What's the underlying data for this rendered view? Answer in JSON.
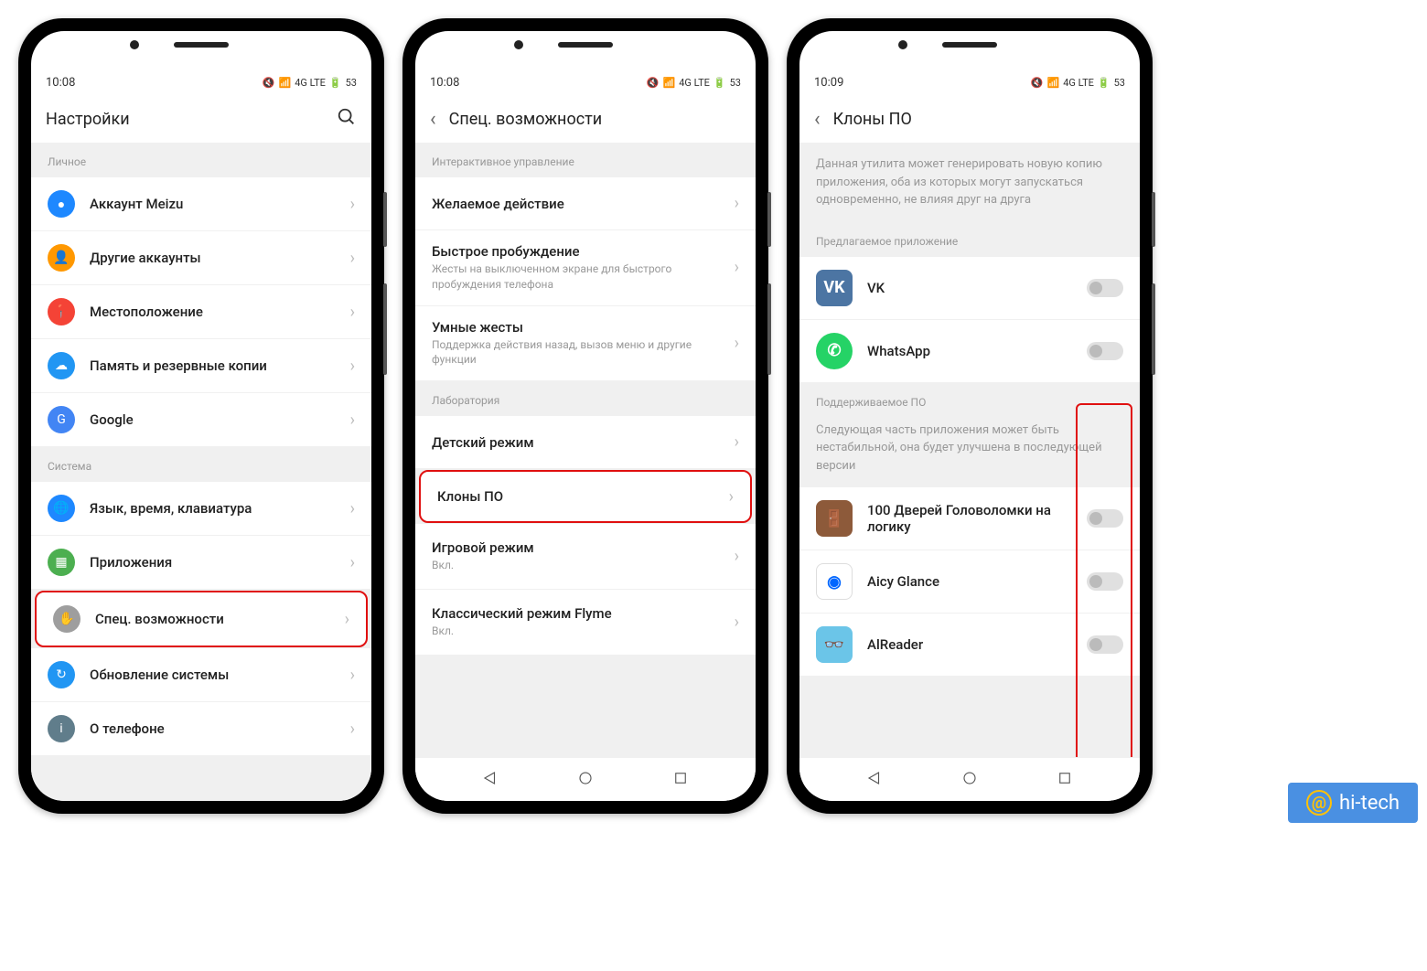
{
  "watermark": "hi-tech",
  "phone1": {
    "time": "10:08",
    "battery": "53",
    "net": "4G LTE",
    "title": "Настройки",
    "sections": [
      {
        "header": "Личное",
        "items": [
          {
            "label": "Аккаунт Meizu",
            "color": "#1e88ff",
            "glyph": "●"
          },
          {
            "label": "Другие аккаунты",
            "color": "#ff9800",
            "glyph": "👤"
          },
          {
            "label": "Местоположение",
            "color": "#f44336",
            "glyph": "📍"
          },
          {
            "label": "Память и резервные копии",
            "color": "#2196f3",
            "glyph": "☁"
          },
          {
            "label": "Google",
            "color": "#4285f4",
            "glyph": "G"
          }
        ]
      },
      {
        "header": "Система",
        "items": [
          {
            "label": "Язык, время, клавиатура",
            "color": "#1e88ff",
            "glyph": "🌐"
          },
          {
            "label": "Приложения",
            "color": "#4caf50",
            "glyph": "▦"
          },
          {
            "label": "Спец. возможности",
            "color": "#9e9e9e",
            "glyph": "✋",
            "highlight": true
          },
          {
            "label": "Обновление системы",
            "color": "#2196f3",
            "glyph": "↻"
          },
          {
            "label": "О телефоне",
            "color": "#607d8b",
            "glyph": "i"
          }
        ]
      }
    ]
  },
  "phone2": {
    "time": "10:08",
    "battery": "53",
    "net": "4G LTE",
    "title": "Спец. возможности",
    "sections": [
      {
        "header": "Интерактивное управление",
        "items": [
          {
            "label": "Желаемое действие"
          },
          {
            "label": "Быстрое пробуждение",
            "sub": "Жесты на выключенном экране для быстрого пробуждения телефона"
          },
          {
            "label": "Умные жесты",
            "sub": "Поддержка действия назад, вызов меню и другие функции"
          }
        ]
      },
      {
        "header": "Лаборатория",
        "items": [
          {
            "label": "Детский режим"
          },
          {
            "label": "Клоны ПО",
            "highlight": true
          },
          {
            "label": "Игровой режим",
            "sub": "Вкл."
          },
          {
            "label": "Классический режим Flyme",
            "sub": "Вкл."
          }
        ]
      }
    ]
  },
  "phone3": {
    "time": "10:09",
    "battery": "53",
    "net": "4G LTE",
    "title": "Клоны ПО",
    "intro": "Данная утилита может генерировать новую копию приложения, оба из которых могут запускаться одновременно, не влияя друг на друга",
    "sec1_header": "Предлагаемое приложение",
    "apps1": [
      {
        "label": "VK",
        "color": "#4c75a3",
        "glyph": "VK"
      },
      {
        "label": "WhatsApp",
        "color": "#25d366",
        "glyph": "✆",
        "round": true
      }
    ],
    "sec2_header": "Поддерживаемое ПО",
    "sec2_desc": "Следующая часть приложения может быть нестабильной, она будет улучшена в последующей версии",
    "apps2": [
      {
        "label": "100 Дверей Головоломки на логику",
        "color": "#8d5a3a",
        "glyph": "🚪"
      },
      {
        "label": "Aicy Glance",
        "color": "#fff",
        "glyph": "◉",
        "ring": true
      },
      {
        "label": "AlReader",
        "color": "#6bc5e8",
        "glyph": "👓"
      }
    ]
  }
}
